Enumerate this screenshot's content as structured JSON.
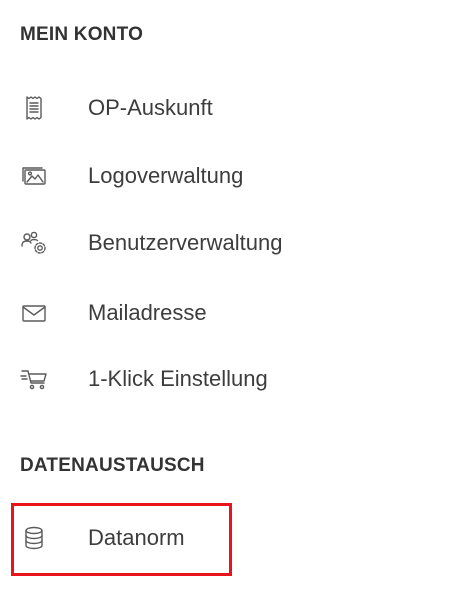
{
  "sections": {
    "account": {
      "title": "MEIN KONTO",
      "items": [
        {
          "label": "OP-Auskunft",
          "icon": "receipt-icon"
        },
        {
          "label": "Logoverwaltung",
          "icon": "images-icon"
        },
        {
          "label": "Benutzerverwaltung",
          "icon": "users-settings-icon"
        },
        {
          "label": "Mailadresse",
          "icon": "envelope-icon"
        },
        {
          "label": "1-Klick Einstellung",
          "icon": "fast-cart-icon"
        }
      ]
    },
    "exchange": {
      "title": "DATENAUSTAUSCH",
      "items": [
        {
          "label": "Datanorm",
          "icon": "database-icon"
        }
      ]
    }
  },
  "highlight_color": "#e8141b"
}
